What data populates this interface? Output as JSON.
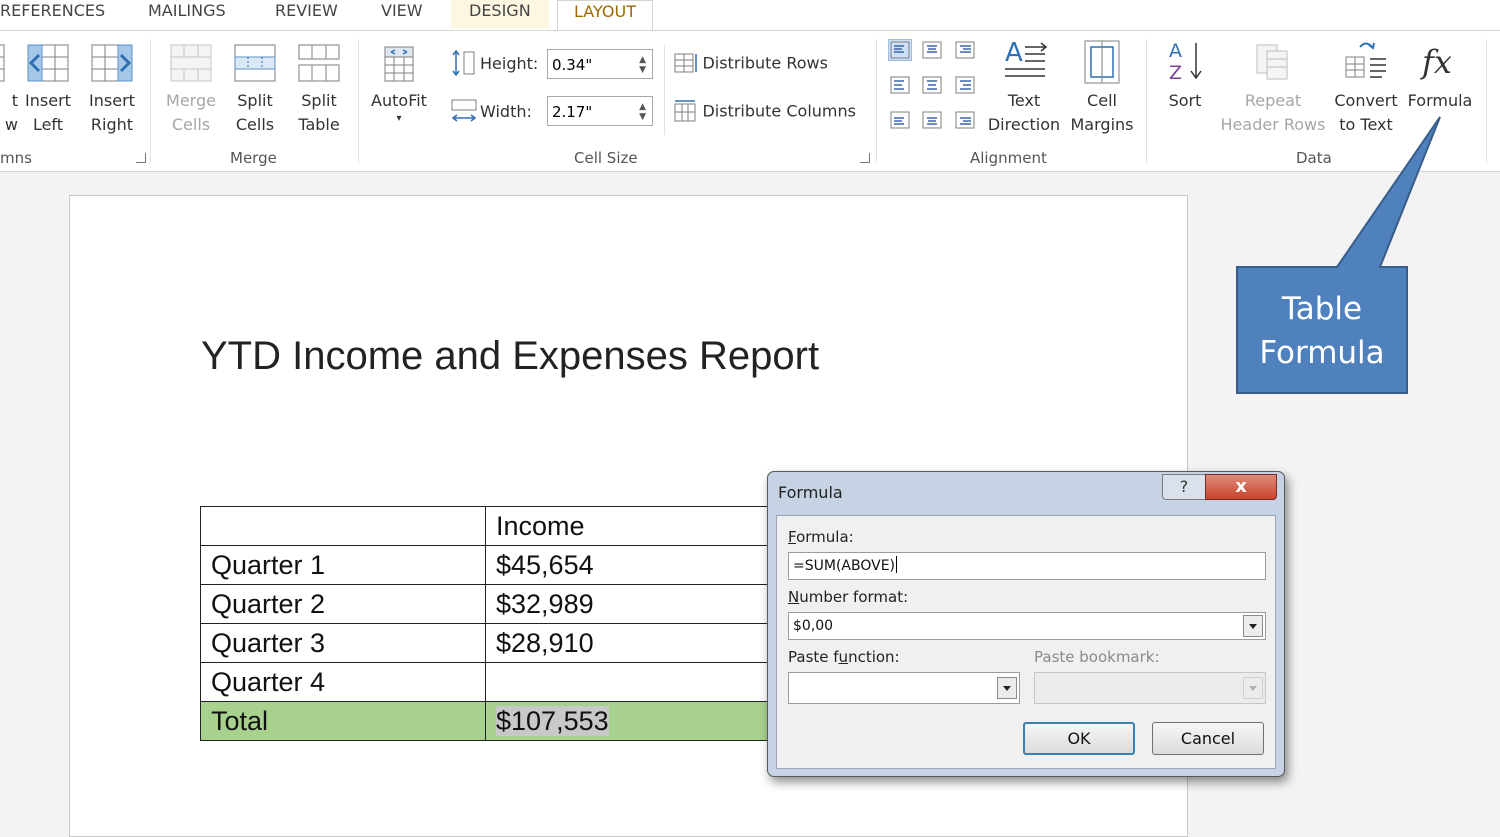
{
  "tabs": {
    "references": "REFERENCES",
    "mailings": "MAILINGS",
    "review": "REVIEW",
    "view": "VIEW",
    "design": "DESIGN",
    "layout": "LAYOUT"
  },
  "ribbon": {
    "rows_columns": {
      "insert_below": [
        "t",
        "w"
      ],
      "insert_left": [
        "Insert",
        "Left"
      ],
      "insert_right": [
        "Insert",
        "Right"
      ],
      "group_label": "mns"
    },
    "merge": {
      "merge_cells": [
        "Merge",
        "Cells"
      ],
      "split_cells": [
        "Split",
        "Cells"
      ],
      "split_table": [
        "Split",
        "Table"
      ],
      "group_label": "Merge"
    },
    "cell_size": {
      "autofit": "AutoFit",
      "height_label": "Height:",
      "height_value": "0.34\"",
      "width_label": "Width:",
      "width_value": "2.17\"",
      "distribute_rows": "Distribute Rows",
      "distribute_columns": "Distribute Columns",
      "group_label": "Cell Size"
    },
    "alignment": {
      "text_direction": [
        "Text",
        "Direction"
      ],
      "cell_margins": [
        "Cell",
        "Margins"
      ],
      "group_label": "Alignment"
    },
    "data": {
      "sort": "Sort",
      "repeat_header_rows": [
        "Repeat",
        "Header Rows"
      ],
      "convert_to_text": [
        "Convert",
        "to Text"
      ],
      "formula": "Formula",
      "group_label": "Data"
    }
  },
  "document": {
    "title": "YTD Income and Expenses Report",
    "table": {
      "header": [
        "",
        "Income",
        ""
      ],
      "rows": [
        {
          "label": "Quarter 1",
          "income": "$45,654"
        },
        {
          "label": "Quarter 2",
          "income": "$32,989"
        },
        {
          "label": "Quarter 3",
          "income": "$28,910"
        },
        {
          "label": "Quarter 4",
          "income": ""
        }
      ],
      "total": {
        "label": "Total",
        "income": "$107,553"
      }
    }
  },
  "callout": {
    "line1": "Table",
    "line2": "Formula",
    "fill": "#4f81bd",
    "stroke": "#385d8a"
  },
  "dialog": {
    "title": "Formula",
    "help": "?",
    "close": "x",
    "formula_label_accel": "F",
    "formula_label_rest": "ormula:",
    "formula_value": "=SUM(ABOVE)",
    "number_format_label_accel": "N",
    "number_format_label_rest": "umber format:",
    "number_format_value": "$0,00",
    "paste_function_label_pre": "Paste f",
    "paste_function_label_accel": "u",
    "paste_function_label_post": "nction:",
    "paste_bookmark_label": "Paste bookmark:",
    "ok": "OK",
    "cancel": "Cancel"
  },
  "colors": {
    "total_row": "#a9d18e",
    "layout_tab_text": "#9c6a00",
    "close_button": "#c7442c"
  }
}
